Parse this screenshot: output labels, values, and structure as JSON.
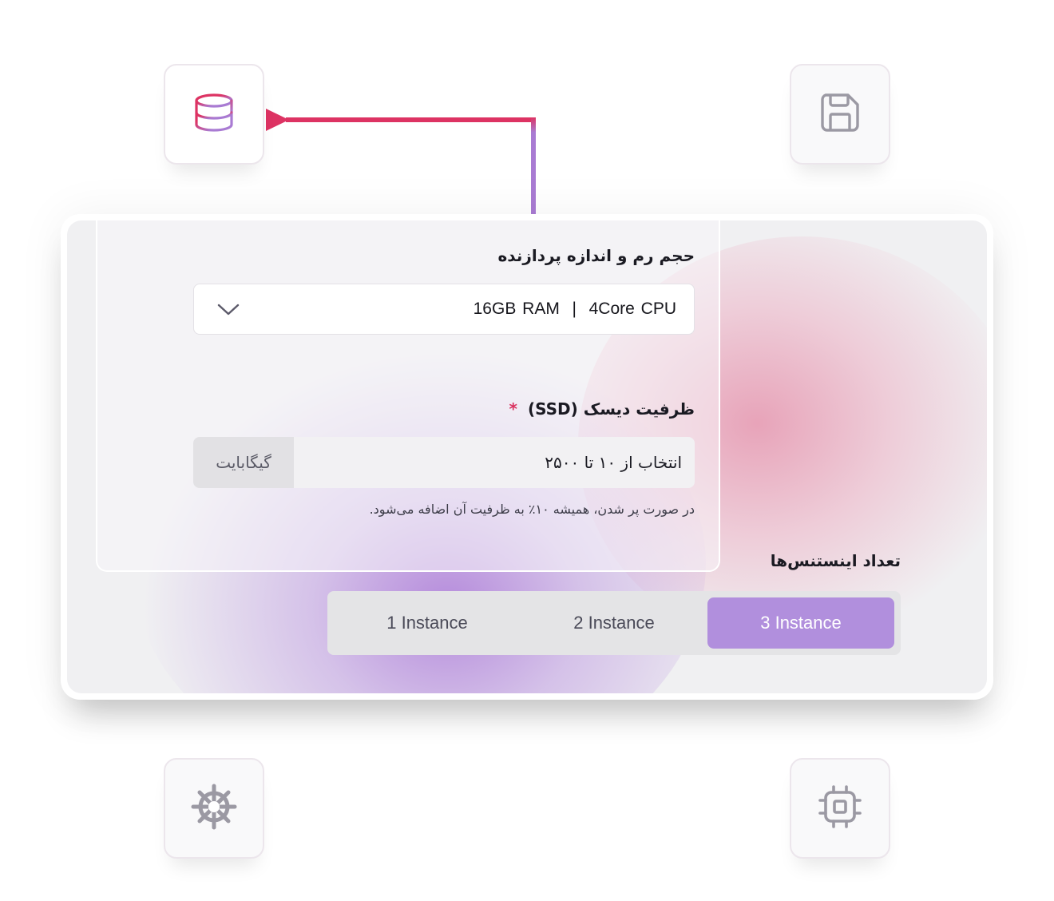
{
  "icons": {
    "top_left": "database-icon",
    "top_right": "save-icon",
    "bottom_left": "helm-icon",
    "bottom_right": "cpu-icon"
  },
  "colors": {
    "accent_pink": "#dd3363",
    "accent_purple": "#a97bd3",
    "selected_segment": "#b18fdd",
    "required_star": "#d9325f",
    "icon_gray": "#9b99a3"
  },
  "form": {
    "ram_cpu": {
      "label": "حجم رم و اندازه پردازنده",
      "selected_value": "16GB RAM  |  4Core CPU"
    },
    "disk": {
      "label": "ظرفیت دیسک (SSD)",
      "required_mark": "*",
      "placeholder": "انتخاب از ۱۰ تا ۲۵۰۰",
      "unit": "گیگابایت",
      "help_text": "در صورت پر شدن، همیشه ۱۰٪ به ظرفیت آن اضافه می‌شود."
    },
    "instances": {
      "label": "تعداد اینستنس‌ها",
      "options": [
        {
          "label": "1 Instance",
          "selected": false
        },
        {
          "label": "2 Instance",
          "selected": false
        },
        {
          "label": "3 Instance",
          "selected": true
        }
      ]
    }
  }
}
